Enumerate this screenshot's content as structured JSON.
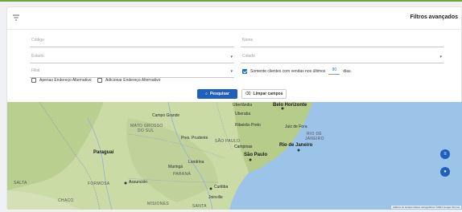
{
  "header": {
    "title": "Filtros avançados",
    "filter_icon": "filter-icon"
  },
  "form": {
    "codigo_placeholder": "Código",
    "nome_placeholder": "Nome",
    "estado_placeholder": "Estado",
    "cidade_placeholder": "Cidade",
    "filial_placeholder": "Filial",
    "somente_label": "Somente clientes com vendas nos últimos",
    "somente_checked": true,
    "days_value": "90",
    "days_suffix": "dias.",
    "apenas_label": "Apenas Endereço Alternativo",
    "adicionar_label": "Adicionar Endereço Alternativo",
    "pesquisar_label": "Pesquisar",
    "limpar_label": "Limpar campos"
  },
  "map": {
    "labels": {
      "belo_horizonte": "Belo Horizonte",
      "mato_grosso": "MATO GROSSO",
      "do_sul": "DO SUL",
      "campo_grande": "Campo Grande",
      "uberlandia": "Uberlândia",
      "uberaba": "Uberaba",
      "ribeirao_preto": "Ribeirão Preto",
      "sao_paulo_state": "SÃO PAULO",
      "campinas": "Campinas",
      "sao_paulo_city": "São Paulo",
      "rio_de_janeiro": "Rio de Janeiro",
      "rio_state": "RIO DE",
      "rio_state2": "JANEIRO",
      "juiz_de_fora": "Juiz de Fora",
      "paraguai": "Paraguai",
      "parana": "PARANÁ",
      "curitiba": "Curitiba",
      "assuncao": "Assunción",
      "formosa": "FORMOSA",
      "salta": "SALTA",
      "chaco": "CHACO",
      "misiones": "MISIONES",
      "presidente_prudente": "Pres. Prudente",
      "londrina": "Londrina",
      "maringa": "Maringá",
      "joinville": "Joinville",
      "santa": "SANTA"
    },
    "attribution": "Atalhos do teclado   Dados cartográficos ©2024 Google   Termos"
  },
  "colors": {
    "primary": "#1f5fbd",
    "accent_green": "#6fa63a",
    "sea": "#9cc3e8",
    "land": "#c9d9a6"
  }
}
